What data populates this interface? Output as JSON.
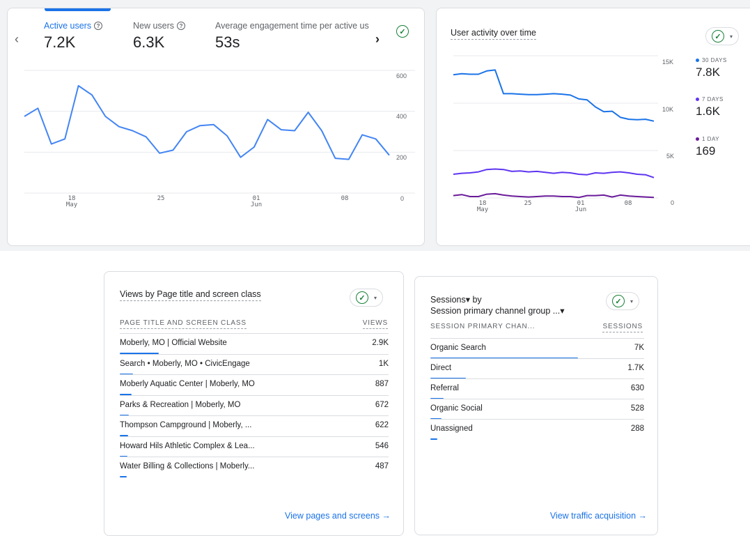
{
  "main_card": {
    "metrics": [
      {
        "label": "Active users",
        "value": "7.2K"
      },
      {
        "label": "New users",
        "value": "6.3K"
      },
      {
        "label": "Average engagement time per active us",
        "value": "53s"
      }
    ],
    "help_glyph": "?",
    "prev_glyph": "‹",
    "next_glyph": "›",
    "check_glyph": "✓",
    "y_ticks": [
      "600",
      "400",
      "200",
      "0"
    ],
    "x_ticks": [
      {
        "day": "18",
        "month": "May"
      },
      {
        "day": "25",
        "month": ""
      },
      {
        "day": "01",
        "month": "Jun"
      },
      {
        "day": "08",
        "month": ""
      }
    ],
    "line_color": "#4285f4"
  },
  "chart_data": [
    {
      "type": "line",
      "title": "",
      "xlabel": "",
      "ylabel": "",
      "ylim": [
        0,
        600
      ],
      "x_tick_labels": [
        "18 May",
        "25",
        "01 Jun",
        "08"
      ],
      "series": [
        {
          "name": "Active users",
          "values": [
            375,
            415,
            240,
            265,
            525,
            480,
            375,
            325,
            305,
            275,
            195,
            210,
            300,
            330,
            335,
            280,
            175,
            225,
            360,
            310,
            305,
            395,
            305,
            170,
            165,
            285,
            265,
            185
          ]
        }
      ]
    },
    {
      "type": "line",
      "title": "User activity over time",
      "xlabel": "",
      "ylabel": "",
      "ylim": [
        0,
        15000
      ],
      "x_tick_labels": [
        "18 May",
        "25",
        "01 Jun",
        "08"
      ],
      "series": [
        {
          "name": "30 DAYS",
          "values": [
            13000,
            13100,
            13050,
            13050,
            13400,
            13500,
            11000,
            11000,
            10950,
            10900,
            10900,
            10950,
            11000,
            10950,
            10850,
            10450,
            10350,
            9600,
            9100,
            9150,
            8500,
            8300,
            8250,
            8300,
            8100
          ]
        },
        {
          "name": "7 DAYS",
          "values": [
            2500,
            2600,
            2650,
            2750,
            3000,
            3050,
            3000,
            2800,
            2850,
            2750,
            2800,
            2700,
            2600,
            2700,
            2650,
            2500,
            2450,
            2650,
            2600,
            2700,
            2750,
            2650,
            2500,
            2450,
            2150
          ]
        },
        {
          "name": "1 DAY",
          "values": [
            250,
            350,
            150,
            150,
            400,
            450,
            300,
            200,
            150,
            100,
            150,
            200,
            200,
            150,
            150,
            50,
            250,
            250,
            300,
            100,
            300,
            200,
            150,
            100,
            50
          ]
        }
      ]
    }
  ],
  "activity_card": {
    "title": "User activity over time",
    "check_glyph": "✓",
    "caret_glyph": "▾",
    "y_ticks": [
      "15K",
      "10K",
      "5K",
      "0"
    ],
    "x_ticks": [
      {
        "day": "18",
        "month": "May"
      },
      {
        "day": "25",
        "month": ""
      },
      {
        "day": "01",
        "month": "Jun"
      },
      {
        "day": "08",
        "month": ""
      }
    ],
    "legend": [
      {
        "label": "30 DAYS",
        "value": "7.8K",
        "color": "#1a73e8"
      },
      {
        "label": "7 DAYS",
        "value": "1.6K",
        "color": "#5e35f1"
      },
      {
        "label": "1 DAY",
        "value": "169",
        "color": "#6a1b9a"
      }
    ]
  },
  "pages_card": {
    "title": "Views by Page title and screen class",
    "check_glyph": "✓",
    "caret_glyph": "▾",
    "col_label": "PAGE TITLE AND SCREEN CLASS",
    "col_value": "VIEWS",
    "rows": [
      {
        "label": "Moberly, MO | Official Website",
        "value": "2.9K",
        "share": 1.0
      },
      {
        "label": "Search • Moberly, MO • CivicEngage",
        "value": "1K",
        "share": 0.34
      },
      {
        "label": "Moberly Aquatic Center | Moberly, MO",
        "value": "887",
        "share": 0.3
      },
      {
        "label": "Parks & Recreation | Moberly, MO",
        "value": "672",
        "share": 0.23
      },
      {
        "label": "Thompson Campground | Moberly, ...",
        "value": "622",
        "share": 0.21
      },
      {
        "label": "Howard Hils Athletic Complex & Lea...",
        "value": "546",
        "share": 0.19
      },
      {
        "label": "Water Billing & Collections | Moberly...",
        "value": "487",
        "share": 0.17
      }
    ],
    "footer_link": "View pages and screens →"
  },
  "sessions_card": {
    "title_line1": "Sessions▾ by",
    "title_line2": "Session primary channel group ...▾",
    "check_glyph": "✓",
    "caret_glyph": "▾",
    "col_label": "SESSION PRIMARY CHAN...",
    "col_value": "SESSIONS",
    "rows": [
      {
        "label": "Organic Search",
        "value": "7K",
        "share": 1.0
      },
      {
        "label": "Direct",
        "value": "1.7K",
        "share": 0.24
      },
      {
        "label": "Referral",
        "value": "630",
        "share": 0.09
      },
      {
        "label": "Organic Social",
        "value": "528",
        "share": 0.075
      },
      {
        "label": "Unassigned",
        "value": "288",
        "share": 0.041
      }
    ],
    "footer_link": "View traffic acquisition →"
  }
}
